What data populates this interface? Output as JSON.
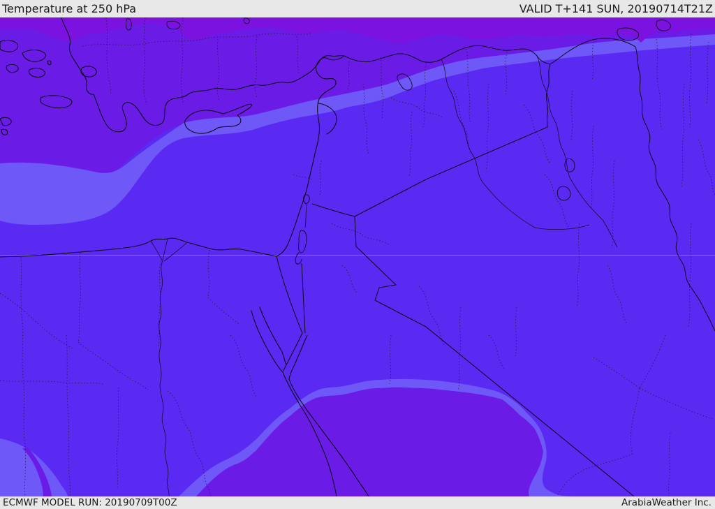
{
  "header": {
    "title": "Temperature at 250 hPa",
    "valid_time": "VALID T+141 SUN, 20190714T21Z"
  },
  "footer": {
    "model_run": "ECMWF MODEL RUN: 20190709T00Z",
    "provider": "ArabiaWeather Inc."
  },
  "map": {
    "parameter": "Temperature",
    "level": "250 hPa",
    "colors": {
      "coldest_band": "#7c12e0",
      "violet_band": "#6a1ce6",
      "blue_band": "#5a2af2",
      "light_band": "#6e58f8",
      "line": "#0d0a18",
      "bar_background": "#e8e8e8",
      "bar_text": "#1b1b1b",
      "graticule": "#cfc8ff"
    }
  }
}
